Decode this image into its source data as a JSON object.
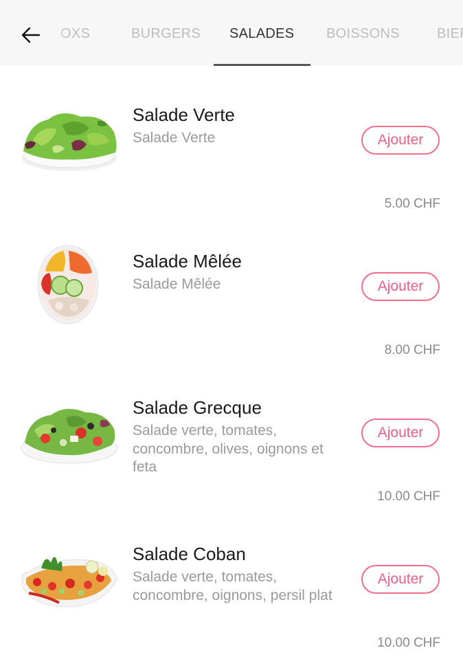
{
  "header": {
    "tabs": [
      {
        "label": "OXS",
        "active": false
      },
      {
        "label": "BURGERS",
        "active": false
      },
      {
        "label": "SALADES",
        "active": true
      },
      {
        "label": "BOISSONS",
        "active": false
      },
      {
        "label": "BIER",
        "active": false
      }
    ]
  },
  "items": [
    {
      "name": "Salade Verte",
      "description": "Salade Verte",
      "button": "Ajouter",
      "price": "5.00 CHF",
      "image": "green-salad-bowl"
    },
    {
      "name": "Salade Mêlée",
      "description": "Salade Mêlée",
      "button": "Ajouter",
      "price": "8.00 CHF",
      "image": "mixed-salad-plate"
    },
    {
      "name": "Salade Grecque",
      "description": "Salade verte, tomates, concombre, olives, oignons et feta",
      "button": "Ajouter",
      "price": "10.00 CHF",
      "image": "greek-salad-bowl"
    },
    {
      "name": "Salade Coban",
      "description": "Salade verte, tomates, concombre, oignons, persil plat",
      "button": "Ajouter",
      "price": "10.00 CHF",
      "image": "coban-salad-plate"
    }
  ],
  "colors": {
    "accent": "#f06d8e",
    "header_bg": "#f7f7f7"
  }
}
